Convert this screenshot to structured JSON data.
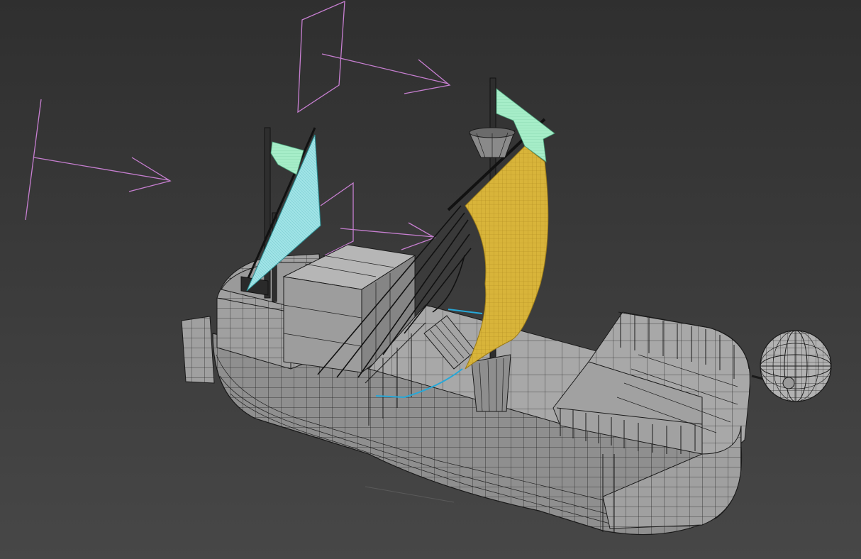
{
  "viewport": {
    "background_top": "#2f2f2f",
    "background_bottom": "#474747",
    "render_mode": "wireframe-on-shaded"
  },
  "colors": {
    "hull": "#9c9c9c",
    "wire": "#1a1a1a",
    "force_helper": "#c77fd1",
    "sail_main": "#d8b43a",
    "sail_aux": "#a6edc8",
    "sail_jib": "#9fe3e6",
    "spline_cyan": "#27a8d8",
    "mast": "#2e2e2e"
  },
  "objects": [
    {
      "name": "ship-hull",
      "kind": "editable-poly"
    },
    {
      "name": "main-sail",
      "kind": "cloth"
    },
    {
      "name": "jib-sail",
      "kind": "cloth"
    },
    {
      "name": "top-flag",
      "kind": "cloth"
    },
    {
      "name": "rear-flag",
      "kind": "cloth"
    },
    {
      "name": "wind-helper-1",
      "kind": "space-warp"
    },
    {
      "name": "wind-helper-2",
      "kind": "space-warp"
    },
    {
      "name": "wind-helper-3",
      "kind": "space-warp"
    },
    {
      "name": "figurehead-sphere",
      "kind": "geosphere"
    },
    {
      "name": "crows-nest",
      "kind": "cone"
    }
  ]
}
